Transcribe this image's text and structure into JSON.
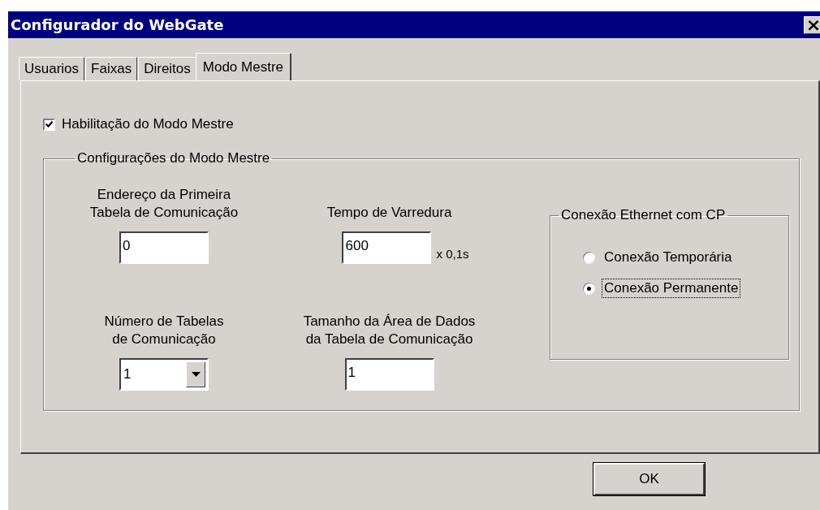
{
  "window": {
    "title": "Configurador do WebGate",
    "close": "×"
  },
  "tabs": [
    {
      "label": "Usuarios",
      "selected": false
    },
    {
      "label": "Faixas",
      "selected": false
    },
    {
      "label": "Direitos",
      "selected": false
    },
    {
      "label": "Modo Mestre",
      "selected": true
    }
  ],
  "enable_checkbox": {
    "label": "Habilitação do Modo Mestre",
    "checked": true
  },
  "settings_group": {
    "legend": "Configurações do Modo Mestre",
    "fields": [
      {
        "kind": "text",
        "label_lines": [
          "Endereço da Primeira",
          "Tabela de Comunicação"
        ],
        "value": "0"
      },
      {
        "kind": "text",
        "label_lines": [
          "Tempo de Varredura"
        ],
        "value": "600",
        "suffix": "x 0,1s"
      },
      {
        "kind": "combo",
        "label_lines": [
          "Número de Tabelas",
          "de Comunicação"
        ],
        "value": "1"
      },
      {
        "kind": "text",
        "label_lines": [
          "Tamanho da Área de Dados",
          "da Tabela de Comunicação"
        ],
        "value": "1"
      }
    ],
    "connection_group": {
      "legend": "Conexão Ethernet com CP",
      "options": [
        {
          "label": "Conexão Temporária",
          "selected": false,
          "focused": false
        },
        {
          "label": "Conexão Permanente",
          "selected": true,
          "focused": true
        }
      ]
    }
  },
  "buttons": [
    "OK"
  ]
}
